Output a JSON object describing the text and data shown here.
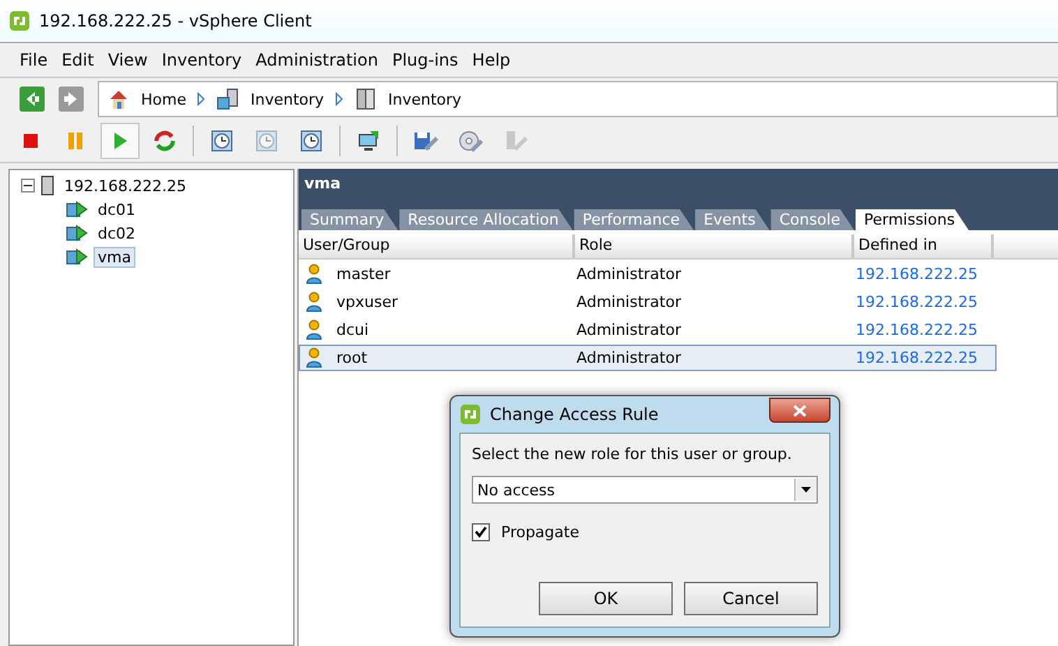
{
  "window": {
    "title": "192.168.222.25 - vSphere Client"
  },
  "menu": [
    "File",
    "Edit",
    "View",
    "Inventory",
    "Administration",
    "Plug-ins",
    "Help"
  ],
  "nav_buttons": [
    {
      "kind": "back",
      "disabled": false
    },
    {
      "kind": "forward",
      "disabled": true
    }
  ],
  "breadcrumb": [
    {
      "kind": "home",
      "label": "Home"
    },
    {
      "kind": "hosts",
      "label": "Inventory"
    },
    {
      "kind": "server",
      "label": "Inventory"
    }
  ],
  "toolbar": [
    {
      "kind": "stop",
      "disabled": false,
      "selected": false
    },
    {
      "kind": "pause",
      "disabled": false,
      "selected": false
    },
    {
      "kind": "play",
      "disabled": false,
      "selected": true
    },
    {
      "kind": "reset",
      "disabled": false,
      "selected": false
    },
    {
      "kind": "snapshot",
      "disabled": false,
      "selected": false,
      "group_start": true
    },
    {
      "kind": "revert",
      "disabled": true,
      "selected": false
    },
    {
      "kind": "manager",
      "disabled": false,
      "selected": false
    },
    {
      "kind": "console",
      "disabled": false,
      "selected": false,
      "group_start": true
    },
    {
      "kind": "edit",
      "disabled": false,
      "selected": false,
      "group_start": true
    },
    {
      "kind": "cd",
      "disabled": false,
      "selected": false
    },
    {
      "kind": "usb",
      "disabled": true,
      "selected": false
    }
  ],
  "tree": {
    "label": "192.168.222.25",
    "expanded": true,
    "children": [
      {
        "label": "dc01",
        "selected": false
      },
      {
        "label": "dc02",
        "selected": false
      },
      {
        "label": "vma",
        "selected": true
      }
    ]
  },
  "panel": {
    "title": "vma",
    "tabs": [
      {
        "label": "Summary",
        "selected": false
      },
      {
        "label": "Resource Allocation",
        "selected": false
      },
      {
        "label": "Performance",
        "selected": false
      },
      {
        "label": "Events",
        "selected": false
      },
      {
        "label": "Console",
        "selected": false
      },
      {
        "label": "Permissions",
        "selected": true
      }
    ],
    "table": {
      "columns": [
        "User/Group",
        "Role",
        "Defined in"
      ],
      "rows": [
        {
          "user": "master",
          "role": "Administrator",
          "defined_in": "192.168.222.25",
          "selected": false
        },
        {
          "user": "vpxuser",
          "role": "Administrator",
          "defined_in": "192.168.222.25",
          "selected": false
        },
        {
          "user": "dcui",
          "role": "Administrator",
          "defined_in": "192.168.222.25",
          "selected": false
        },
        {
          "user": "root",
          "role": "Administrator",
          "defined_in": "192.168.222.25",
          "selected": true
        }
      ]
    }
  },
  "dialog": {
    "title": "Change Access Rule",
    "prompt": "Select the new role for this user or group.",
    "role": "No access",
    "propagate": {
      "label": "Propagate",
      "checked": true
    },
    "buttons": [
      "OK",
      "Cancel"
    ]
  }
}
